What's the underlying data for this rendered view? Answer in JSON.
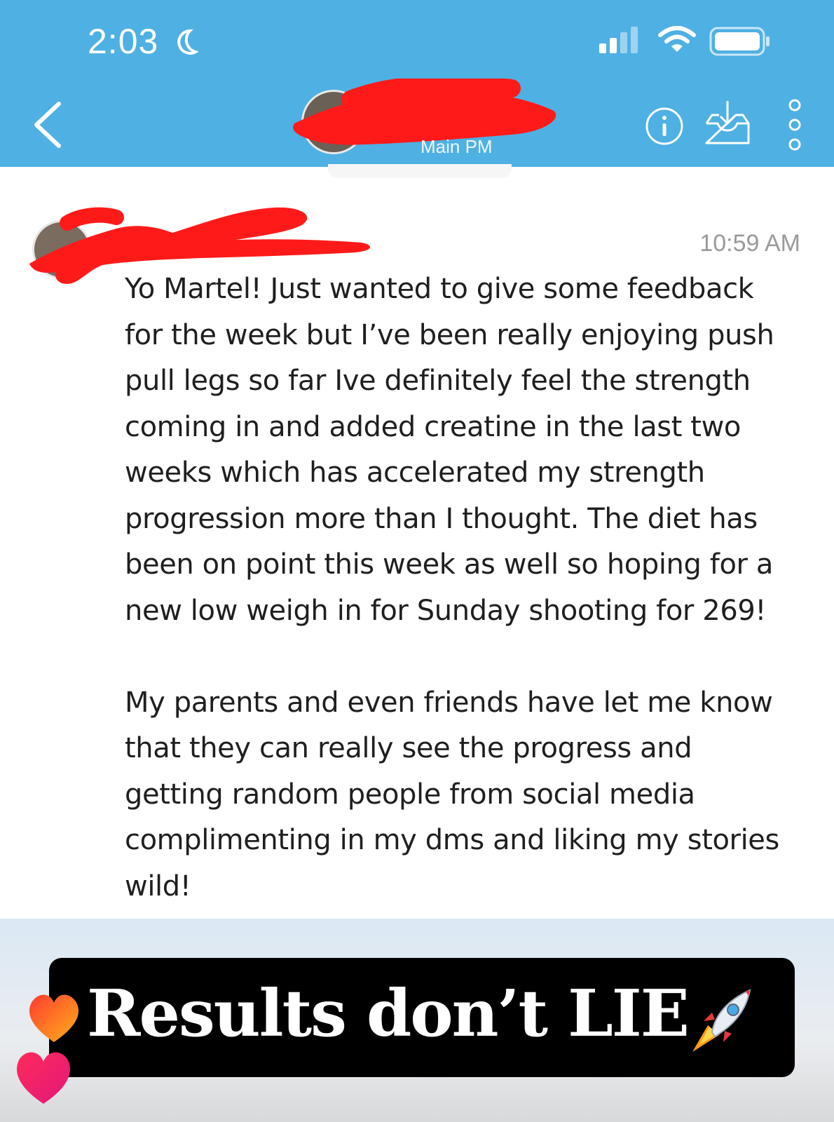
{
  "status_bar": {
    "time": "2:03"
  },
  "header": {
    "subtitle": "Main PM"
  },
  "message": {
    "time": "10:59 AM",
    "text": "Yo Martel! Just wanted to give some feedback\nfor the week but I’ve been really enjoying push\npull legs so far Ive definitely feel the strength\ncoming in and added creatine in the last two\nweeks which has accelerated my strength\nprogression more than I thought. The diet has\nbeen on point this week as well so hoping for a\nnew low weigh in for Sunday shooting for 269!\n\nMy parents and even friends have let me know\nthat they can really see the progress and\ngetting random people from social media\ncomplimenting in my dms and liking my stories\nwild!"
  },
  "story_overlay": {
    "caption": "Results don’t LIE"
  },
  "icons": {
    "status": [
      "moon-icon",
      "signal-icon",
      "wifi-icon",
      "battery-icon"
    ],
    "header": [
      "back-icon",
      "info-icon",
      "inbox-download-icon",
      "more-vertical-icon"
    ],
    "stickers": [
      "rocket-icon",
      "heart-orange-icon",
      "heart-pink-icon"
    ]
  },
  "colors": {
    "header_bg": "#4fb0e3",
    "redaction": "#ff0000",
    "caption_bg": "#000000",
    "caption_text": "#ffffff"
  }
}
